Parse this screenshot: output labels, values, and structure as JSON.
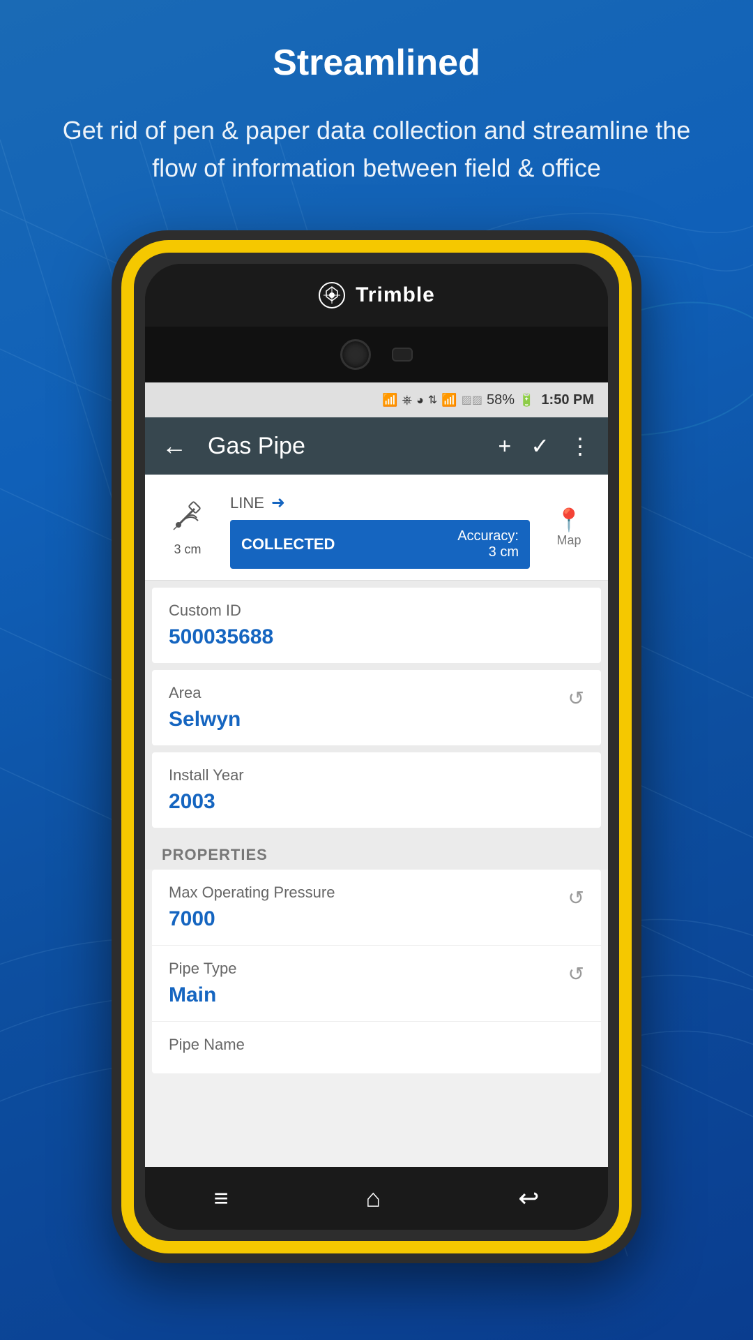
{
  "page": {
    "title": "Streamlined",
    "subtitle": "Get rid of pen & paper data collection and streamline the flow of information between field & office"
  },
  "device": {
    "brand": "Trimble"
  },
  "status_bar": {
    "battery": "58%",
    "time": "1:50 PM"
  },
  "header": {
    "title": "Gas Pipe",
    "back_label": "←",
    "add_label": "+",
    "check_label": "✓",
    "more_label": "⋮"
  },
  "gps_bar": {
    "accuracy": "3 cm",
    "line_label": "LINE",
    "collected_label": "COLLECTED",
    "accuracy_label": "Accuracy:",
    "accuracy_value": "3 cm",
    "map_label": "Map"
  },
  "fields": [
    {
      "label": "Custom ID",
      "value": "500035688",
      "has_icon": false
    },
    {
      "label": "Area",
      "value": "Selwyn",
      "has_icon": true
    },
    {
      "label": "Install Year",
      "value": "2003",
      "has_icon": false
    }
  ],
  "properties_section": {
    "title": "PROPERTIES",
    "items": [
      {
        "label": "Max Operating Pressure",
        "value": "7000",
        "has_icon": true
      },
      {
        "label": "Pipe Type",
        "value": "Main",
        "has_icon": true
      },
      {
        "label": "Pipe Name",
        "value": "",
        "has_icon": false
      }
    ]
  },
  "nav": {
    "menu_icon": "≡",
    "home_icon": "⌂",
    "back_icon": "↩"
  },
  "colors": {
    "accent": "#1565c0",
    "header_bg": "#37474f",
    "collected_bg": "#1565c0",
    "text_value": "#1565c0"
  }
}
